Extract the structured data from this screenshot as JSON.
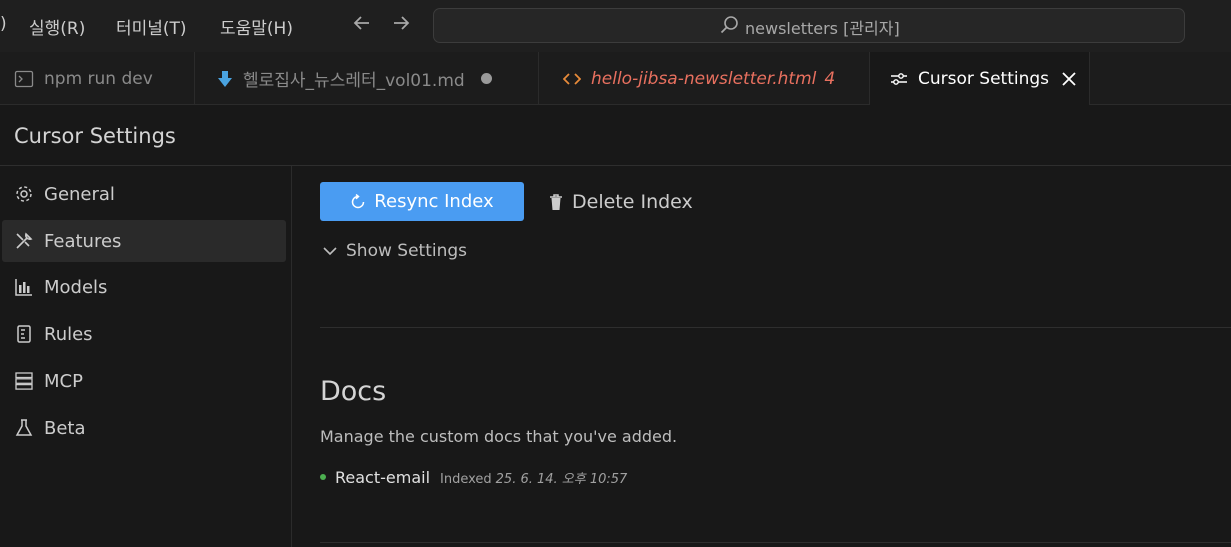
{
  "menu": {
    "fragment": ")",
    "run": "실행(R)",
    "terminal": "터미널(T)",
    "help": "도움말(H)"
  },
  "nav": {
    "back_icon": "arrow-left-icon",
    "forward_icon": "arrow-right-icon"
  },
  "search": {
    "text": "newsletters [관리자]",
    "icon": "search-icon"
  },
  "tabs": [
    {
      "label": "npm run dev",
      "icon": "terminal-icon"
    },
    {
      "label": "헬로집사_뉴스레터_vol01.md",
      "icon": "markdown-download-icon",
      "modified": true
    },
    {
      "label": "hello-jibsa-newsletter.html",
      "badge": "4",
      "icon": "code-icon"
    },
    {
      "label": "Cursor Settings",
      "icon": "sliders-icon",
      "close_icon": "close-icon"
    }
  ],
  "settings_title": "Cursor Settings",
  "sidebar": {
    "items": [
      {
        "label": "General",
        "icon": "gear-icon"
      },
      {
        "label": "Features",
        "icon": "tools-icon",
        "active": true
      },
      {
        "label": "Models",
        "icon": "bar-chart-icon"
      },
      {
        "label": "Rules",
        "icon": "rules-icon"
      },
      {
        "label": "MCP",
        "icon": "server-icon"
      },
      {
        "label": "Beta",
        "icon": "flask-icon"
      }
    ]
  },
  "indexing": {
    "resync_label": "Resync Index",
    "delete_label": "Delete Index",
    "show_settings_label": "Show Settings"
  },
  "docs": {
    "title": "Docs",
    "description": "Manage the custom docs that you've added.",
    "items": [
      {
        "name": "React-email",
        "status": "Indexed",
        "date": "25. 6. 14. 오후 10:57"
      }
    ]
  },
  "colors": {
    "primary_button": "#4a9cf2",
    "tab_warning": "#e8705f",
    "indexed_dot": "#4caf50",
    "background": "#181818"
  }
}
